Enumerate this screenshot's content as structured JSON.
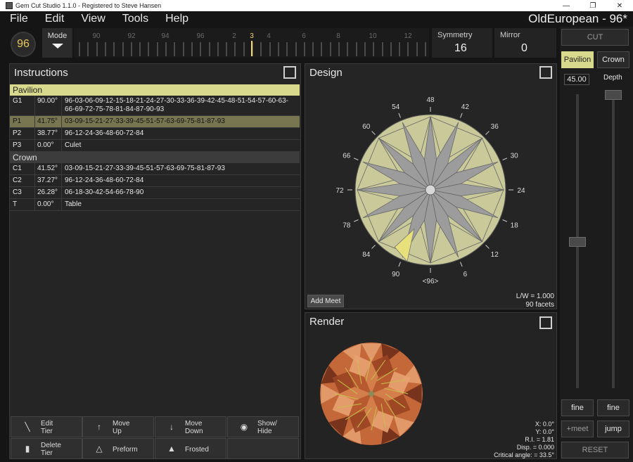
{
  "titlebar": {
    "text": "Gem Cut Studio 1.1.0 - Registered to Steve Hansen",
    "min": "—",
    "max": "❐",
    "close": "✕"
  },
  "menu": {
    "items": [
      "File",
      "Edit",
      "View",
      "Tools",
      "Help"
    ],
    "doc_title": "OldEuropean - 96*"
  },
  "toolbar": {
    "index": "96",
    "mode_label": "Mode",
    "ruler_labels": [
      "90",
      "92",
      "94",
      "96",
      "2",
      "3",
      "4",
      "6",
      "8",
      "10",
      "12"
    ],
    "ruler_current": "3",
    "symmetry_label": "Symmetry",
    "symmetry_value": "16",
    "mirror_label": "Mirror",
    "mirror_value": "0"
  },
  "instructions": {
    "title": "Instructions",
    "sections": [
      {
        "name": "Pavilion",
        "rows": [
          {
            "tier": "G1",
            "angle": "90.00°",
            "indexes": "96-03-06-09-12-15-18-21-24-27-30-33-36-39-42-45-48-51-54-57-60-63-66-69-72-75-78-81-84-87-90-93"
          },
          {
            "tier": "P1",
            "angle": "41.75°",
            "indexes": "03-09-15-21-27-33-39-45-51-57-63-69-75-81-87-93"
          },
          {
            "tier": "P2",
            "angle": "38.77°",
            "indexes": "96-12-24-36-48-60-72-84"
          },
          {
            "tier": "P3",
            "angle": "0.00°",
            "indexes": "Culet"
          }
        ]
      },
      {
        "name": "Crown",
        "rows": [
          {
            "tier": "C1",
            "angle": "41.52°",
            "indexes": "03-09-15-21-27-33-39-45-51-57-63-69-75-81-87-93"
          },
          {
            "tier": "C2",
            "angle": "37.27°",
            "indexes": "96-12-24-36-48-60-72-84"
          },
          {
            "tier": "C3",
            "angle": "26.28°",
            "indexes": "06-18-30-42-54-66-78-90"
          },
          {
            "tier": "T",
            "angle": "0.00°",
            "indexes": "Table"
          }
        ]
      }
    ],
    "buttons": {
      "edit_tier": "Edit\nTier",
      "move_up": "Move\nUp",
      "move_down": "Move\nDown",
      "show_hide": "Show/\nHide",
      "delete_tier": "Delete\nTier",
      "preform": "Preform",
      "frosted": "Frosted"
    }
  },
  "design": {
    "title": "Design",
    "index_labels": [
      "48",
      "42",
      "36",
      "30",
      "24",
      "18",
      "12",
      "6",
      "<96>",
      "90",
      "84",
      "78",
      "72",
      "66",
      "60",
      "54"
    ],
    "add_meet": "Add Meet",
    "lw": "L/W = 1.000",
    "facets": "90 facets",
    "colors": {
      "outer": "#c9c99a",
      "inner": "#9c9c9c",
      "hilite": "#e8e07a"
    }
  },
  "render": {
    "title": "Render",
    "x": "X: 0.0°",
    "y": "Y: 0.0°",
    "ri": "R.I. = 1.81",
    "disp": "Disp. = 0.000",
    "critical": "Critical angle: = 33.5°",
    "colors": {
      "base": "#c4683a",
      "light": "#e8a272",
      "dark": "#6a2a16",
      "lines": "#c8c04a"
    }
  },
  "controls": {
    "cut": "CUT",
    "pavilion": "Pavilion",
    "crown": "Crown",
    "angle_value": "45.00",
    "depth_label": "Depth",
    "fine1": "fine",
    "fine2": "fine",
    "meet": "+meet",
    "jump": "jump",
    "reset": "RESET"
  }
}
